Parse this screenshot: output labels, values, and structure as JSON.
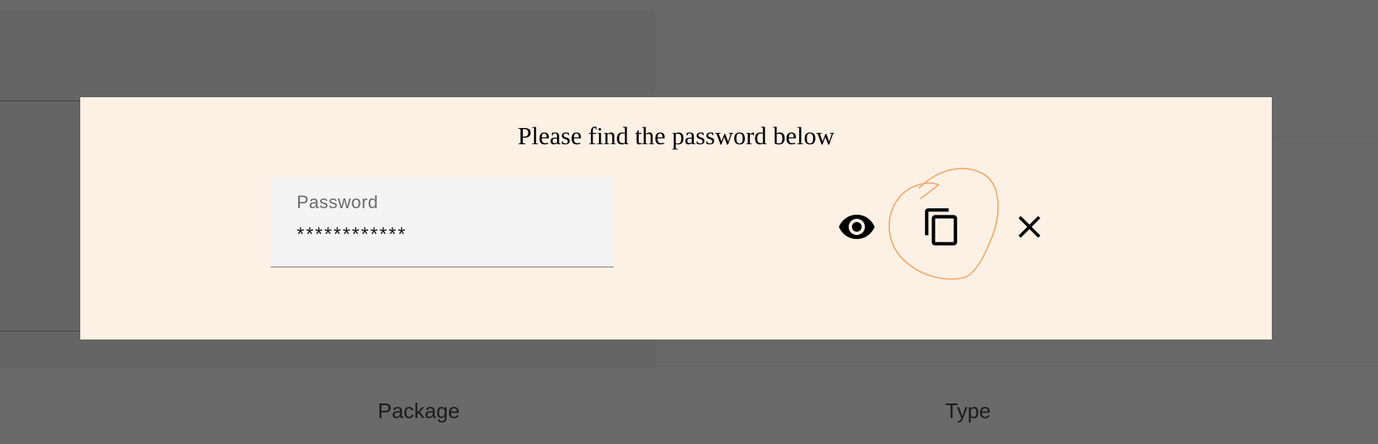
{
  "background": {
    "columns": [
      "Package",
      "Type"
    ]
  },
  "dialog": {
    "title": "Please find the password below",
    "password_field": {
      "label": "Password",
      "value": "************"
    },
    "actions": {
      "show": "eye-icon",
      "copy": "copy-icon",
      "close": "close-icon"
    }
  },
  "colors": {
    "overlay": "#696969",
    "dialog_bg": "#fdf1e5",
    "field_bg": "#f4f4f4",
    "annotation": "#f0a86a"
  }
}
